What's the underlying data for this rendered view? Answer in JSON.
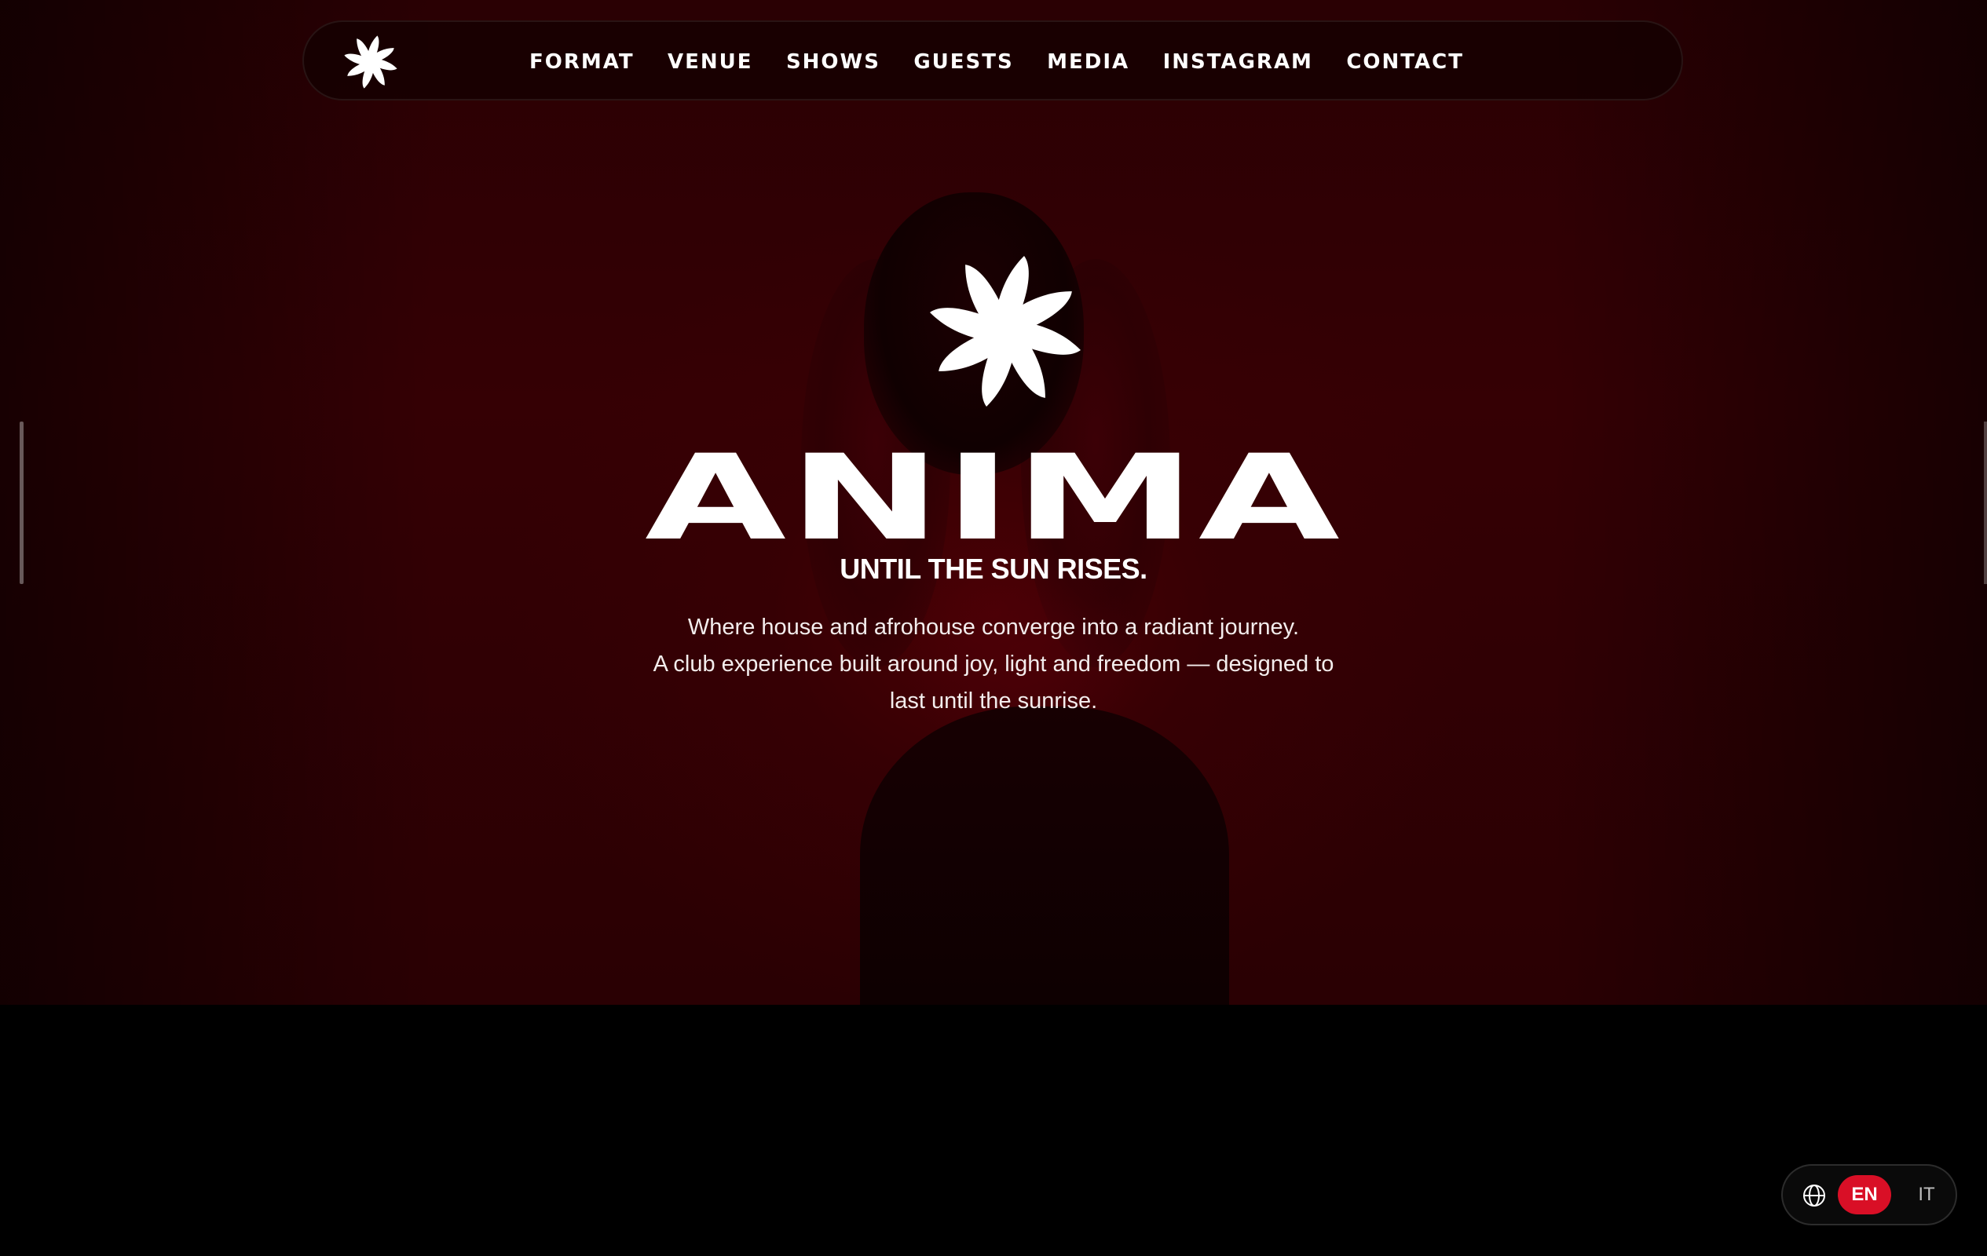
{
  "nav": {
    "logo_icon": "anima-sun-icon",
    "links": [
      {
        "label": "FORMAT"
      },
      {
        "label": "VENUE"
      },
      {
        "label": "SHOWS"
      },
      {
        "label": "GUESTS"
      },
      {
        "label": "MEDIA"
      },
      {
        "label": "INSTAGRAM"
      },
      {
        "label": "CONTACT"
      }
    ]
  },
  "hero": {
    "logo_icon": "anima-sun-icon",
    "title": "ANIMA",
    "tagline": "UNTIL THE SUN RISES.",
    "description_lines": [
      "Where house and afrohouse converge into a radiant journey.",
      "A club experience built around joy, light and freedom — designed to",
      "last until the sunrise."
    ]
  },
  "language": {
    "icon": "globe-icon",
    "options": [
      "EN",
      "IT"
    ],
    "selected": "EN",
    "accent_color": "#d90f26"
  },
  "colors": {
    "background": "#000000",
    "hero_tint": "#3a0004",
    "text": "#ffffff"
  }
}
